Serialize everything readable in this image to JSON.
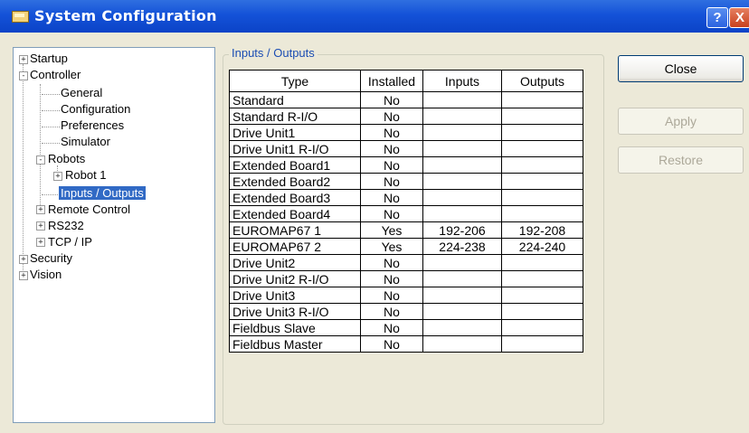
{
  "window": {
    "title": "System Configuration",
    "help_label": "?",
    "close_label": "X"
  },
  "tree": {
    "startup": "Startup",
    "controller": "Controller",
    "general": "General",
    "configuration": "Configuration",
    "preferences": "Preferences",
    "simulator": "Simulator",
    "robots": "Robots",
    "robot1": "Robot 1",
    "io": "Inputs / Outputs",
    "remote": "Remote Control",
    "rs232": "RS232",
    "tcpip": "TCP / IP",
    "security": "Security",
    "vision": "Vision"
  },
  "group": {
    "label": "Inputs / Outputs"
  },
  "table": {
    "headers": {
      "type": "Type",
      "installed": "Installed",
      "inputs": "Inputs",
      "outputs": "Outputs"
    },
    "rows": [
      {
        "type": "Standard",
        "installed": "No",
        "inputs": "",
        "outputs": ""
      },
      {
        "type": "Standard R-I/O",
        "installed": "No",
        "inputs": "",
        "outputs": ""
      },
      {
        "type": "Drive Unit1",
        "installed": "No",
        "inputs": "",
        "outputs": ""
      },
      {
        "type": "Drive Unit1 R-I/O",
        "installed": "No",
        "inputs": "",
        "outputs": ""
      },
      {
        "type": "Extended Board1",
        "installed": "No",
        "inputs": "",
        "outputs": ""
      },
      {
        "type": "Extended Board2",
        "installed": "No",
        "inputs": "",
        "outputs": ""
      },
      {
        "type": "Extended Board3",
        "installed": "No",
        "inputs": "",
        "outputs": ""
      },
      {
        "type": "Extended Board4",
        "installed": "No",
        "inputs": "",
        "outputs": ""
      },
      {
        "type": "EUROMAP67 1",
        "installed": "Yes",
        "inputs": "192-206",
        "outputs": "192-208"
      },
      {
        "type": "EUROMAP67 2",
        "installed": "Yes",
        "inputs": "224-238",
        "outputs": "224-240"
      },
      {
        "type": "Drive Unit2",
        "installed": "No",
        "inputs": "",
        "outputs": ""
      },
      {
        "type": "Drive Unit2 R-I/O",
        "installed": "No",
        "inputs": "",
        "outputs": ""
      },
      {
        "type": "Drive Unit3",
        "installed": "No",
        "inputs": "",
        "outputs": ""
      },
      {
        "type": "Drive Unit3 R-I/O",
        "installed": "No",
        "inputs": "",
        "outputs": ""
      },
      {
        "type": "Fieldbus Slave",
        "installed": "No",
        "inputs": "",
        "outputs": ""
      },
      {
        "type": "Fieldbus Master",
        "installed": "No",
        "inputs": "",
        "outputs": ""
      }
    ]
  },
  "buttons": {
    "close": "Close",
    "apply": "Apply",
    "restore": "Restore"
  }
}
